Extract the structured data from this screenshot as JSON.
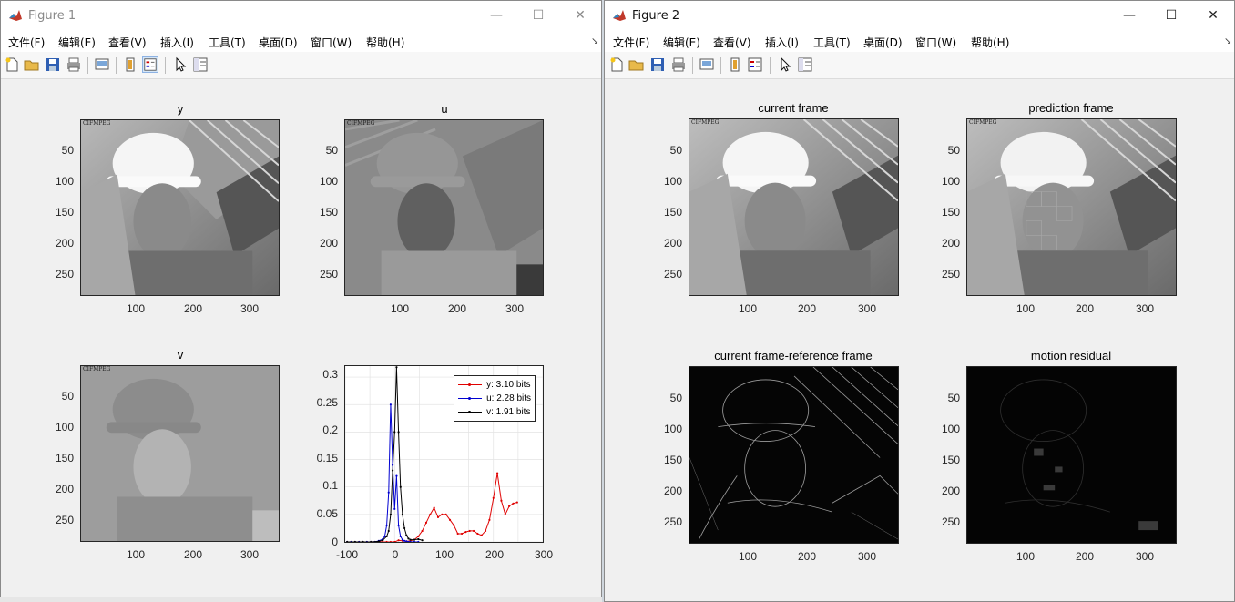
{
  "windows": [
    {
      "title": "Figure 1",
      "menus": [
        "文件(F)",
        "编辑(E)",
        "查看(V)",
        "插入(I)",
        "工具(T)",
        "桌面(D)",
        "窗口(W)",
        "帮助(H)"
      ],
      "plots": {
        "y": {
          "title": "y",
          "yticks": [
            "50",
            "100",
            "150",
            "200",
            "250"
          ],
          "xticks": [
            "100",
            "200",
            "300"
          ]
        },
        "u": {
          "title": "u",
          "yticks": [
            "50",
            "100",
            "150",
            "200",
            "250"
          ],
          "xticks": [
            "100",
            "200",
            "300"
          ]
        },
        "v": {
          "title": "v",
          "yticks": [
            "50",
            "100",
            "150",
            "200",
            "250"
          ],
          "xticks": [
            "100",
            "200",
            "300"
          ]
        },
        "hist": {
          "yticks": [
            "0",
            "0.05",
            "0.1",
            "0.15",
            "0.2",
            "0.25",
            "0.3"
          ],
          "xticks": [
            "-100",
            "0",
            "100",
            "200",
            "300"
          ]
        }
      },
      "watermark": "CIFMPEG"
    },
    {
      "title": "Figure 2",
      "menus": [
        "文件(F)",
        "编辑(E)",
        "查看(V)",
        "插入(I)",
        "工具(T)",
        "桌面(D)",
        "窗口(W)",
        "帮助(H)"
      ],
      "plots": {
        "current": {
          "title": "current frame",
          "yticks": [
            "50",
            "100",
            "150",
            "200",
            "250"
          ],
          "xticks": [
            "100",
            "200",
            "300"
          ]
        },
        "prediction": {
          "title": "prediction frame",
          "yticks": [
            "50",
            "100",
            "150",
            "200",
            "250"
          ],
          "xticks": [
            "100",
            "200",
            "300"
          ]
        },
        "diff": {
          "title": "current frame-reference frame",
          "yticks": [
            "50",
            "100",
            "150",
            "200",
            "250"
          ],
          "xticks": [
            "100",
            "200",
            "300"
          ]
        },
        "residual": {
          "title": "motion residual",
          "yticks": [
            "50",
            "100",
            "150",
            "200",
            "250"
          ],
          "xticks": [
            "100",
            "200",
            "300"
          ]
        }
      }
    }
  ],
  "window_buttons": {
    "minimize": "—",
    "maximize": "☐",
    "close": "✕"
  },
  "chart_data": {
    "type": "line",
    "xlim": [
      -100,
      300
    ],
    "ylim": [
      0,
      0.32
    ],
    "grid": true,
    "legend_position": "top-right",
    "series": [
      {
        "name": "y: 3.10 bits",
        "color": "#e00000",
        "x": [
          -96,
          -88,
          -80,
          -72,
          -64,
          -56,
          -48,
          -40,
          -32,
          -24,
          -16,
          -8,
          0,
          8,
          16,
          24,
          32,
          40,
          48,
          56,
          64,
          72,
          80,
          88,
          96,
          104,
          112,
          120,
          128,
          136,
          144,
          152,
          160,
          168,
          176,
          184,
          192,
          200,
          208,
          216,
          224,
          232,
          240,
          248
        ],
        "y": [
          0,
          0,
          0,
          0,
          0,
          0,
          0,
          0,
          0,
          0,
          0,
          0,
          0,
          0.003,
          0.002,
          0.001,
          0.002,
          0.004,
          0.01,
          0.02,
          0.035,
          0.05,
          0.062,
          0.045,
          0.05,
          0.05,
          0.04,
          0.03,
          0.015,
          0.015,
          0.018,
          0.02,
          0.02,
          0.015,
          0.012,
          0.02,
          0.04,
          0.08,
          0.125,
          0.075,
          0.05,
          0.065,
          0.07,
          0.072
        ]
      },
      {
        "name": "u: 2.28 bits",
        "color": "#0000d0",
        "x": [
          -96,
          -88,
          -80,
          -72,
          -64,
          -56,
          -48,
          -40,
          -32,
          -24,
          -20,
          -16,
          -12,
          -8,
          -4,
          0,
          4,
          8,
          12,
          16,
          20,
          24,
          28,
          32,
          40,
          48
        ],
        "y": [
          0,
          0,
          0,
          0,
          0,
          0,
          0,
          0,
          0.002,
          0.005,
          0.01,
          0.03,
          0.09,
          0.25,
          0.14,
          0.06,
          0.12,
          0.03,
          0.01,
          0.004,
          0.002,
          0.001,
          0,
          0,
          0,
          0
        ]
      },
      {
        "name": "v: 1.91 bits",
        "color": "#000000",
        "x": [
          -96,
          -80,
          -64,
          -48,
          -32,
          -24,
          -16,
          -12,
          -8,
          -4,
          0,
          4,
          8,
          12,
          16,
          20,
          24,
          28,
          32,
          40,
          48,
          56
        ],
        "y": [
          0,
          0,
          0,
          0,
          0.001,
          0.003,
          0.01,
          0.02,
          0.05,
          0.13,
          0.2,
          0.318,
          0.2,
          0.1,
          0.05,
          0.025,
          0.012,
          0.006,
          0.004,
          0.004,
          0.005,
          0.003
        ]
      }
    ]
  }
}
